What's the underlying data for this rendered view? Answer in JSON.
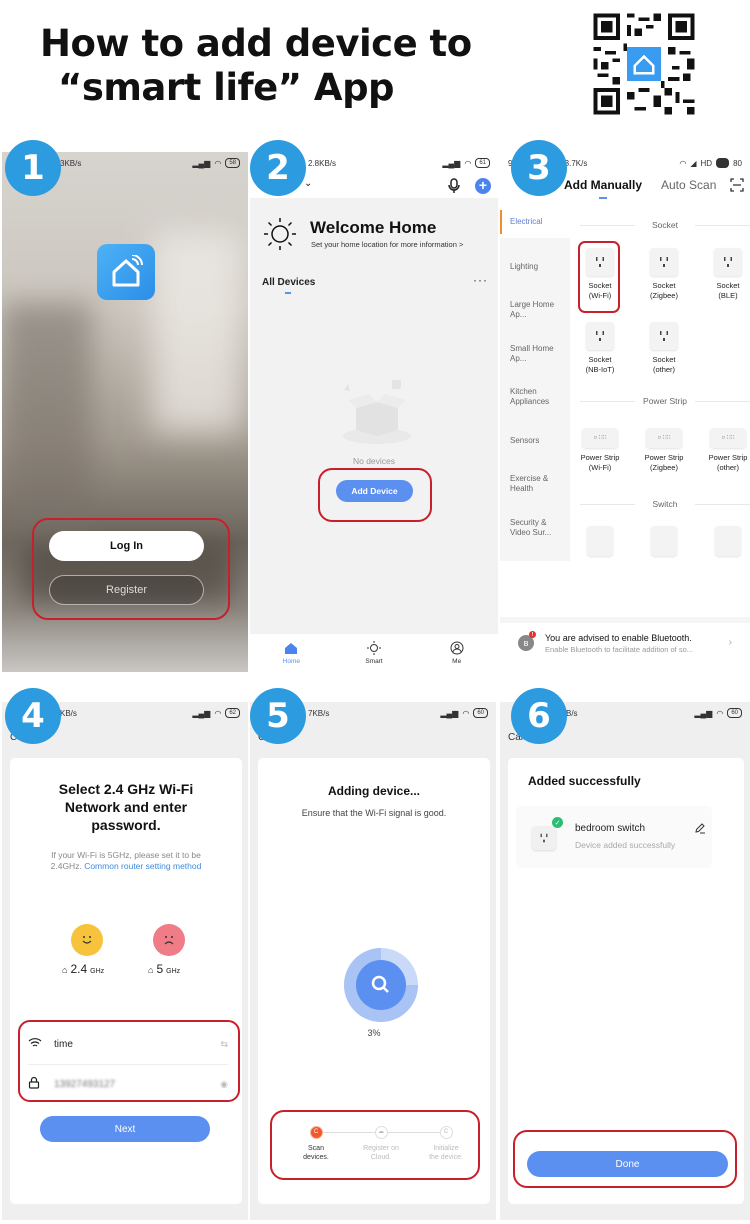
{
  "header": {
    "title_line1": "How to add device to",
    "title_line2": "“smart life”   App",
    "qr_icon": "qr-code-with-smart-life-logo"
  },
  "steps": {
    "step1": {
      "badge": "1",
      "status": {
        "speed": "3KB/s",
        "battery": "58"
      },
      "app_icon": "smart-life-home-icon",
      "login_label": "Log In",
      "register_label": "Register"
    },
    "step2": {
      "badge": "2",
      "status": {
        "speed": "2.8KB/s",
        "battery": "61"
      },
      "welcome_title": "Welcome Home",
      "welcome_sub": "Set your home location for more information  >",
      "all_devices": "All Devices",
      "more": "···",
      "no_devices": "No devices",
      "add_device_label": "Add Device",
      "tabs": [
        {
          "label": "Home",
          "icon": "home-icon",
          "active": true
        },
        {
          "label": "Smart",
          "icon": "sun-icon",
          "active": false
        },
        {
          "label": "Me",
          "icon": "user-icon",
          "active": false
        }
      ]
    },
    "step3": {
      "badge": "3",
      "status": {
        "time": "9:",
        "speed": "3.7K/s",
        "network": "HD",
        "battery": "80"
      },
      "tab_active": "Add Manually",
      "tab_inactive": "Auto Scan",
      "categories": [
        "Electrical",
        "Lighting",
        "Large Home Ap...",
        "Small Home Ap...",
        "Kitchen Appliances",
        "Sensors",
        "Exercise & Health",
        "Security & Video Sur..."
      ],
      "section_socket": "Socket",
      "sockets": [
        {
          "name": "Socket",
          "type": "(Wi-Fi)"
        },
        {
          "name": "Socket",
          "type": "(Zigbee)"
        },
        {
          "name": "Socket",
          "type": "(BLE)"
        },
        {
          "name": "Socket",
          "type": "(NB-IoT)"
        },
        {
          "name": "Socket",
          "type": "(other)"
        }
      ],
      "section_strip": "Power Strip",
      "strips": [
        {
          "name": "Power Strip",
          "type": "(Wi-Fi)"
        },
        {
          "name": "Power Strip",
          "type": "(Zigbee)"
        },
        {
          "name": "Power Strip",
          "type": "(other)"
        }
      ],
      "section_switch": "Switch",
      "bluetooth_title": "You are advised to enable Bluetooth.",
      "bluetooth_sub": "Enable Bluetooth to facilitate addition of so...",
      "bluetooth_alert": "!"
    },
    "step4": {
      "badge": "4",
      "status": {
        "speed": "KB/s",
        "battery": "62"
      },
      "cancel": "Cancel",
      "heading": "Select 2.4 GHz Wi-Fi Network and enter password.",
      "note": "If your Wi-Fi is 5GHz, please set it to be 2.4GHz.",
      "note_link": "Common router setting method",
      "freq_good": "2.4",
      "freq_bad": "5",
      "freq_unit": "GHz",
      "wifi_name": "time",
      "password": "13927493127",
      "next_label": "Next"
    },
    "step5": {
      "badge": "5",
      "status": {
        "speed": "7KB/s",
        "battery": "60"
      },
      "cancel": "Cancel",
      "heading": "Adding device...",
      "sub": "Ensure that the Wi-Fi signal is good.",
      "progress_percent": 3,
      "progress_label": "3%",
      "steps": [
        {
          "label1": "Scan",
          "label2": "devices.",
          "active": true
        },
        {
          "label1": "Register on",
          "label2": "Cloud.",
          "active": false
        },
        {
          "label1": "Initialize",
          "label2": "the device.",
          "active": false
        }
      ]
    },
    "step6": {
      "badge": "6",
      "status": {
        "speed": "B/s",
        "battery": "60"
      },
      "cancel": "Cancel",
      "heading": "Added successfully",
      "device_name": "bedroom switch",
      "device_status": "Device added successfully",
      "done_label": "Done"
    }
  },
  "colors": {
    "accent": "#5b8ff0",
    "badge": "#2c9be0",
    "highlight": "#c8202a",
    "success": "#2fbb74",
    "step_active": "#f0582a"
  }
}
